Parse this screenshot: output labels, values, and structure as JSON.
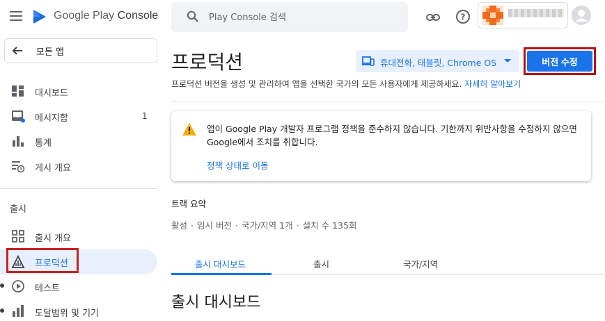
{
  "header": {
    "logo_text_a": "Google Play",
    "logo_text_b": "Console",
    "search_placeholder": "Play Console 검색",
    "icons": [
      "menu-icon",
      "play-console-logo",
      "search-icon",
      "link-icon",
      "help-icon",
      "profile-icon"
    ]
  },
  "sidebar": {
    "back_label": "모든 앱",
    "items": [
      {
        "label": "대시보드",
        "icon": "dashboard-icon"
      },
      {
        "label": "메시지함",
        "icon": "inbox-icon",
        "count": "1"
      },
      {
        "label": "통계",
        "icon": "bar-chart-icon"
      },
      {
        "label": "게시 개요",
        "icon": "publishing-overview-icon"
      }
    ],
    "section_label": "출시",
    "release_items": [
      {
        "label": "출시 개요",
        "icon": "release-overview-icon"
      },
      {
        "label": "프로덕션",
        "icon": "production-icon",
        "active": true
      },
      {
        "label": "테스트",
        "icon": "testing-icon"
      },
      {
        "label": "도달범위 및 기기",
        "icon": "reach-devices-icon"
      }
    ]
  },
  "main": {
    "title": "프로덕션",
    "device_filter": "휴대전화, 태블릿, Chrome OS",
    "edit_button": "버전 수정",
    "subtitle": "프로덕션 버전을 생성 및 관리하여 앱을 선택한 국가의 모든 사용자에게 제공하세요.",
    "learn_more": "자세히 알아보기",
    "warning": {
      "text": "앱이 Google Play 개발자 프로그램 정책을 준수하지 않습니다. 기한까지 위반사항을 수정하지 않으면 Google에서 조치를 취합니다.",
      "link": "정책 상태로 이동"
    },
    "track_title": "트랙 요약",
    "track_summary": [
      "활성",
      "임시 버전",
      "국가/지역 1개",
      "설치 수 135회"
    ],
    "tabs": [
      "출시 대시보드",
      "출시",
      "국가/지역"
    ],
    "section_heading": "출시 대시보드"
  },
  "colors": {
    "accent": "#1a73e8",
    "highlight_box": "#c5221f",
    "warning": "#f9ab00",
    "active_bg": "#e8f0fe"
  }
}
